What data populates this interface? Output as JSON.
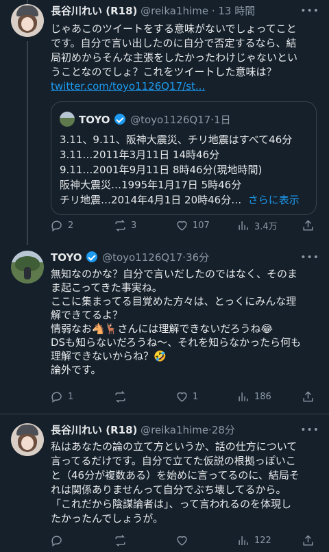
{
  "tweets": [
    {
      "name": "長谷川れい (R18)",
      "handle": "@reika1hime",
      "time": "13 時間",
      "lines": [
        "じゃあこのツイートをする意味がないでしょってこと",
        "です。自分で言い出したのに自分で否定するなら、結",
        "局初めからそんな主張をしたかったわけじゃないとい",
        "うことなのでしょ？これをツイートした意味は？"
      ],
      "link": "twitter.com/toyo1126Q17/st...",
      "quote": {
        "name": "TOYO",
        "handle": "@toyo1126Q17",
        "time": "1日",
        "lines": [
          "3.11、9.11、阪神大震災、チリ地震はすべて46分",
          "3.11…2011年3月11日 14時46分",
          "9.11…2001年9月11日 8時46分(現地時間)",
          "阪神大震災…1995年1月17日 5時46分",
          "チリ地震…2014年4月1日 20時46分…"
        ],
        "show_more": "さらに表示"
      },
      "stats": {
        "replies": "2",
        "retweets": "3",
        "likes": "107",
        "views": "3.4万"
      }
    },
    {
      "name": "TOYO",
      "handle": "@toyo1126Q17",
      "time": "36分",
      "lines": [
        "無知なのかな？自分で言いだしたのではなく、そのま",
        "ま起こってきた事実ね。",
        "ここに集まってる目覚めた方々は、とっくにみんな理",
        "解できてるよ？",
        "情弱なお🐴🦌さんには理解できないだろうね😂",
        "DSも知らないだろうね〜、それを知らなかったら何も",
        "理解できないからね？🤣",
        "論外です。"
      ],
      "stats": {
        "replies": "1",
        "retweets": "",
        "likes": "1",
        "views": "186"
      }
    },
    {
      "name": "長谷川れい (R18)",
      "handle": "@reika1hime",
      "time": "28分",
      "lines": [
        "私はあなたの論の立て方というか、話の仕方について",
        "言ってるだけです。自分で立てた仮説の根拠っぽいこ",
        "と（46分が複数ある）を始めに言ってるのに、結局そ",
        "れは関係ありませんって自分でぶち壊してるから。",
        "「これだから陰謀論者は」、って言われるのを体現し",
        "たかったんでしょうが。"
      ],
      "stats": {
        "replies": "",
        "retweets": "",
        "likes": "",
        "views": "122"
      }
    }
  ],
  "colors": {
    "background": "#15202b",
    "text": "#e7e9ea",
    "muted": "#8b98a5",
    "link": "#1d9bf0",
    "border": "#38444d"
  },
  "icons": {
    "reply": "reply-icon",
    "retweet": "retweet-icon",
    "like": "heart-icon",
    "views": "views-icon",
    "share": "share-icon",
    "verified": "verified-badge-icon",
    "more": "more-icon"
  }
}
